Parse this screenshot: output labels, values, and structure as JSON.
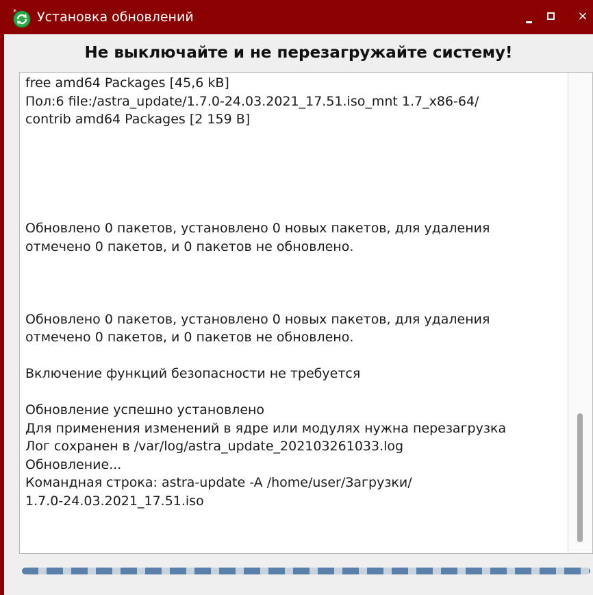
{
  "window": {
    "title": "Установка обновлений",
    "icon": "refresh-icon",
    "controls": {
      "minimize": "minimize-icon",
      "maximize": "maximize-icon",
      "close_label": "×"
    },
    "colors": {
      "titlebar": "#8b0000",
      "background": "#efefef",
      "progress_fill": "#5a7fa8",
      "progress_gap": "#c6d2de"
    }
  },
  "warning": "Не выключайте и не перезагружайте систему!",
  "log": {
    "text": "free amd64 Packages [45,6 kB]\nПол:6 file:/astra_update/1.7.0-24.03.2021_17.51.iso_mnt 1.7_x86-64/\ncontrib amd64 Packages [2 159 B]\n\n\n\n\n\nОбновлено 0 пакетов, установлено 0 новых пакетов, для удаления\nотмечено 0 пакетов, и 0 пакетов не обновлено.\n\n\n\nОбновлено 0 пакетов, установлено 0 новых пакетов, для удаления\nотмечено 0 пакетов, и 0 пакетов не обновлено.\n\nВключение функций безопасности не требуется\n\nОбновление успешно установлено\nДля применения изменений в ядре или модулях нужна перезагрузка\nЛог сохранен в /var/log/astra_update_202103261033.log\nОбновление...\nКомандная строка: astra-update -A /home/user/Загрузки/\n1.7.0-24.03.2021_17.51.iso"
  },
  "progress": {
    "state": "indeterminate"
  }
}
